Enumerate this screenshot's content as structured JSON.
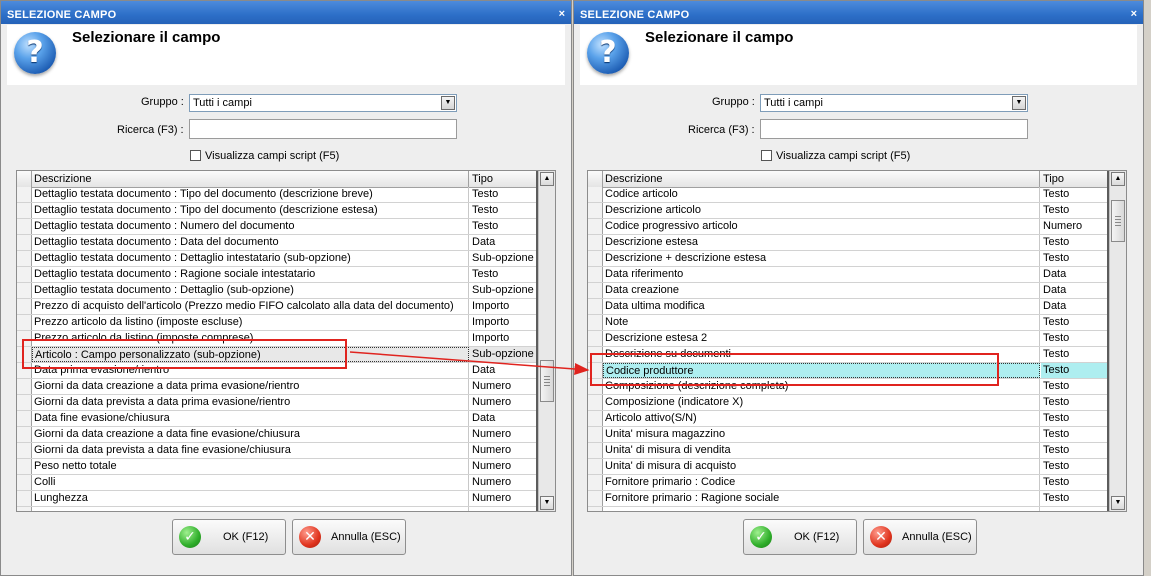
{
  "dialogs": [
    {
      "window_title": "SELEZIONE CAMPO",
      "close_glyph": "×",
      "header_title": "Selezionare il campo",
      "gruppo_label": "Gruppo :",
      "gruppo_value": "Tutti i campi",
      "ricerca_label": "Ricerca (F3) :",
      "ricerca_value": "",
      "script_checkbox_label": "Visualizza campi script (F5)",
      "script_checkbox_checked": false,
      "columns": {
        "descrizione": "Descrizione",
        "tipo": "Tipo"
      },
      "rows": [
        {
          "d": "Dettaglio testata documento : Tipo del documento (descrizione breve)",
          "t": "Testo"
        },
        {
          "d": "Dettaglio testata documento : Tipo del documento (descrizione estesa)",
          "t": "Testo"
        },
        {
          "d": "Dettaglio testata documento : Numero del documento",
          "t": "Testo"
        },
        {
          "d": "Dettaglio testata documento : Data del documento",
          "t": "Data"
        },
        {
          "d": "Dettaglio testata documento : Dettaglio intestatario (sub-opzione)",
          "t": "Sub-opzione"
        },
        {
          "d": "Dettaglio testata documento : Ragione sociale intestatario",
          "t": "Testo"
        },
        {
          "d": "Dettaglio testata documento : Dettaglio (sub-opzione)",
          "t": "Sub-opzione"
        },
        {
          "d": "Prezzo di acquisto dell'articolo (Prezzo medio FIFO calcolato alla data del documento)",
          "t": "Importo"
        },
        {
          "d": "Prezzo articolo da listino (imposte escluse)",
          "t": "Importo"
        },
        {
          "d": "Prezzo articolo da listino (imposte comprese)",
          "t": "Importo"
        },
        {
          "d": "Articolo : Campo personalizzato (sub-opzione)",
          "t": "Sub-opzione",
          "selected": true
        },
        {
          "d": "Data prima evasione/rientro",
          "t": "Data"
        },
        {
          "d": "Giorni da data creazione a data prima evasione/rientro",
          "t": "Numero"
        },
        {
          "d": "Giorni da data prevista a data prima evasione/rientro",
          "t": "Numero"
        },
        {
          "d": "Data fine evasione/chiusura",
          "t": "Data"
        },
        {
          "d": "Giorni da data creazione a data fine evasione/chiusura",
          "t": "Numero"
        },
        {
          "d": "Giorni da data prevista a data fine evasione/chiusura",
          "t": "Numero"
        },
        {
          "d": "Peso netto totale",
          "t": "Numero"
        },
        {
          "d": "Colli",
          "t": "Numero"
        },
        {
          "d": "Lunghezza",
          "t": "Numero"
        },
        {
          "d": "",
          "t": ""
        }
      ],
      "ok_label": "OK (F12)",
      "cancel_label": "Annulla (ESC)",
      "scroll_position": 0.65
    },
    {
      "window_title": "SELEZIONE CAMPO",
      "close_glyph": "×",
      "header_title": "Selezionare il campo",
      "gruppo_label": "Gruppo :",
      "gruppo_value": "Tutti i campi",
      "ricerca_label": "Ricerca (F3) :",
      "ricerca_value": "",
      "script_checkbox_label": "Visualizza campi script (F5)",
      "script_checkbox_checked": false,
      "columns": {
        "descrizione": "Descrizione",
        "tipo": "Tipo"
      },
      "rows": [
        {
          "d": "Codice articolo",
          "t": "Testo"
        },
        {
          "d": "Descrizione articolo",
          "t": "Testo"
        },
        {
          "d": "Codice progressivo articolo",
          "t": "Numero"
        },
        {
          "d": "Descrizione estesa",
          "t": "Testo"
        },
        {
          "d": "Descrizione + descrizione estesa",
          "t": "Testo"
        },
        {
          "d": "Data riferimento",
          "t": "Data"
        },
        {
          "d": "Data creazione",
          "t": "Data"
        },
        {
          "d": "Data ultima modifica",
          "t": "Data"
        },
        {
          "d": "Note",
          "t": "Testo"
        },
        {
          "d": "Descrizione estesa 2",
          "t": "Testo"
        },
        {
          "d": "Descrizione su documenti",
          "t": "Testo"
        },
        {
          "d": "Codice produttore",
          "t": "Testo",
          "highlighted": true
        },
        {
          "d": "Composizione (descrizione completa)",
          "t": "Testo"
        },
        {
          "d": "Composizione (indicatore X)",
          "t": "Testo"
        },
        {
          "d": "Articolo attivo(S/N)",
          "t": "Testo"
        },
        {
          "d": "Unita' misura magazzino",
          "t": "Testo"
        },
        {
          "d": "Unita' di misura di vendita",
          "t": "Testo"
        },
        {
          "d": "Unita' di misura di acquisto",
          "t": "Testo"
        },
        {
          "d": "Fornitore primario : Codice",
          "t": "Testo"
        },
        {
          "d": "Fornitore primario : Ragione sociale",
          "t": "Testo"
        },
        {
          "d": "",
          "t": ""
        }
      ],
      "ok_label": "OK (F12)",
      "cancel_label": "Annulla (ESC)",
      "scroll_position": 0.05
    }
  ],
  "icons": {
    "question": "?",
    "check": "✓",
    "cross": "✕",
    "combo_arrow": "▼",
    "scroll_up": "▲",
    "scroll_down": "▼"
  },
  "colors": {
    "title_bar": "#2d6fc8",
    "highlight_row": "#aeeef0",
    "annotation_red": "#e0241f"
  }
}
